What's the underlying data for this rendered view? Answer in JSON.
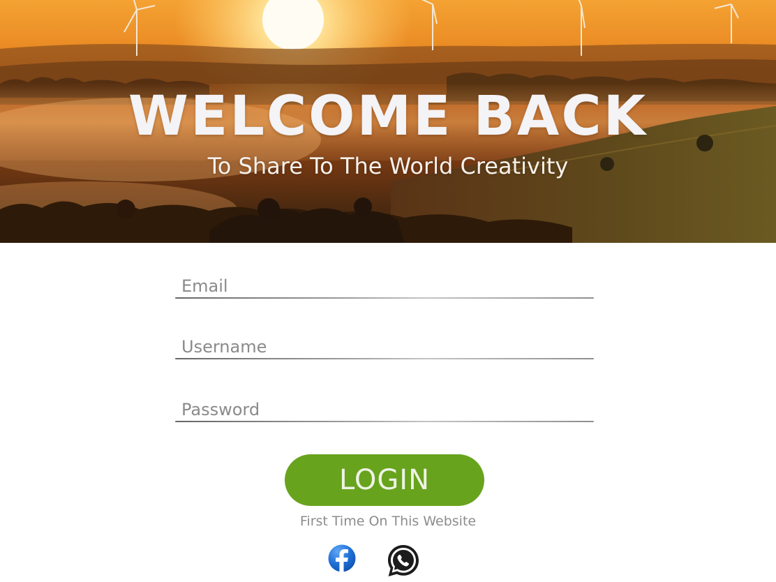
{
  "hero": {
    "title": "WELCOME BACK",
    "subtitle": "To Share To The World Creativity"
  },
  "form": {
    "email": {
      "placeholder": "Email",
      "value": ""
    },
    "username": {
      "placeholder": "Username",
      "value": ""
    },
    "password": {
      "placeholder": "Password",
      "value": ""
    },
    "login_label": "LOGIN",
    "first_time_label": "First Time On This Website"
  },
  "social": {
    "facebook_icon": "facebook-icon",
    "whatsapp_icon": "whatsapp-icon"
  },
  "colors": {
    "accent": "#68a31d",
    "facebook": "#1877f2",
    "whatsapp": "#1e1e1e"
  }
}
